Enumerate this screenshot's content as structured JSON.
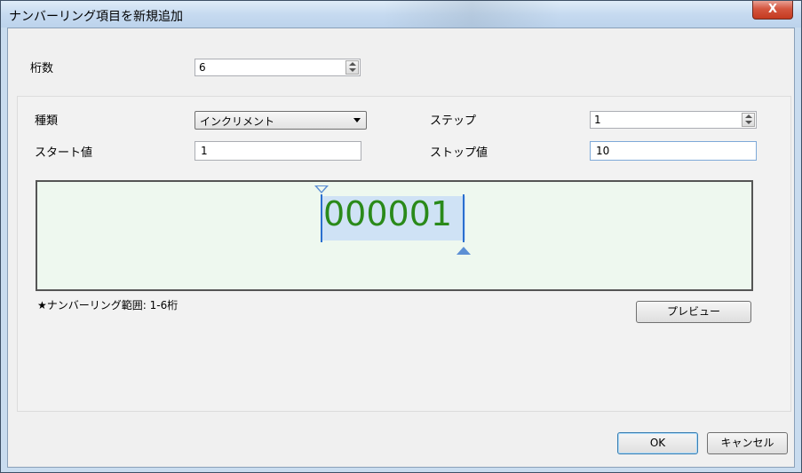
{
  "window": {
    "title": "ナンバーリング項目を新規追加",
    "close_symbol": "X"
  },
  "digits": {
    "label": "桁数",
    "value": "6"
  },
  "type": {
    "label": "種類",
    "selected": "インクリメント"
  },
  "step": {
    "label": "ステップ",
    "value": "1"
  },
  "start": {
    "label": "スタート値",
    "value": "1"
  },
  "stop": {
    "label": "ストップ値",
    "value": "10"
  },
  "preview": {
    "number": "000001",
    "range_note": "★ナンバーリング範囲: 1-6桁",
    "preview_button": "プレビュー"
  },
  "footer": {
    "ok": "OK",
    "cancel": "キャンセル"
  },
  "colors": {
    "number_text": "#2a8a1a",
    "highlight": "#cfe2f5",
    "preview_bg": "#eef8ef",
    "marker": "#5c8fd4"
  }
}
